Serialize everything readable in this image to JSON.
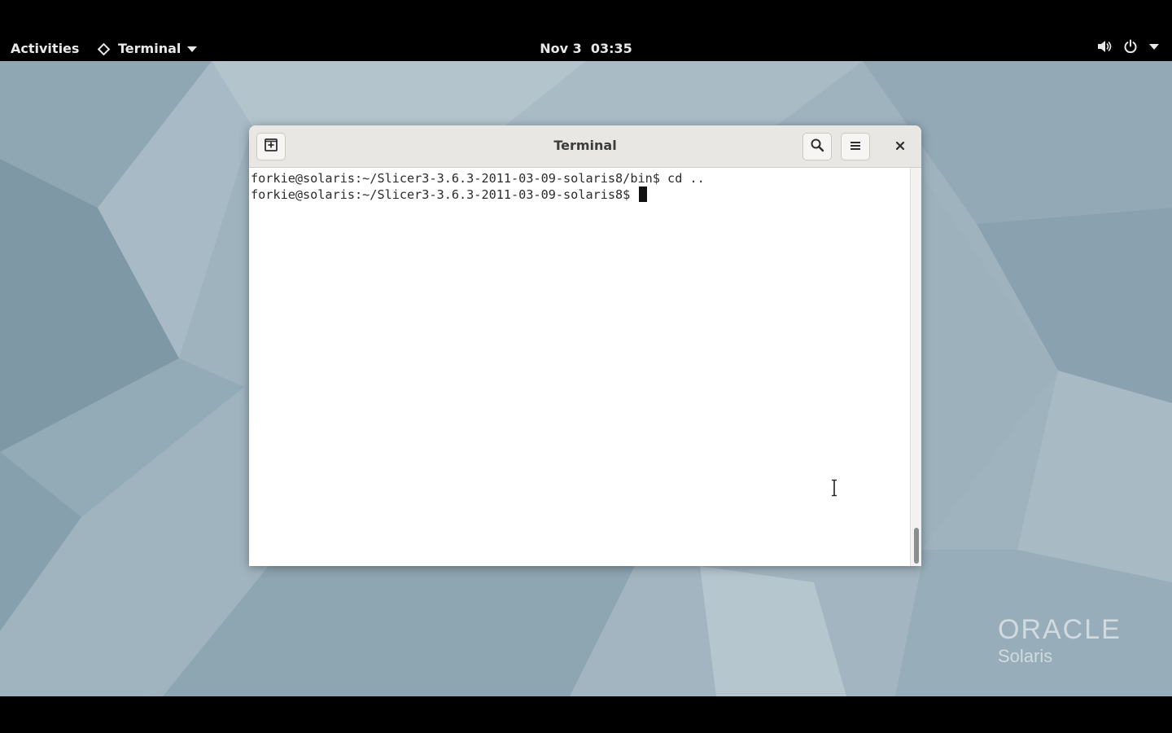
{
  "top_panel": {
    "activities_label": "Activities",
    "app_menu_label": "Terminal",
    "clock": "Nov 3  03:35",
    "icons": [
      "app-diamond-icon",
      "volume-icon",
      "power-icon",
      "system-menu-arrow-icon"
    ]
  },
  "desktop": {
    "logo": {
      "brand": "ORACLE",
      "product": "Solaris"
    }
  },
  "terminal": {
    "title": "Terminal",
    "buttons": [
      "new-tab-icon",
      "search-icon",
      "hamburger-menu-icon",
      "close-icon"
    ],
    "lines": [
      "forkie@solaris:~/Slicer3-3.6.3-2011-03-09-solaris8/bin$ cd ..",
      "forkie@solaris:~/Slicer3-3.6.3-2011-03-09-solaris8$ "
    ]
  },
  "colors": {
    "panel_bg": "#000000",
    "desktop_base": "#9fb3bf",
    "titlebar_bg": "#e9e7e4",
    "terminal_bg": "#ffffff",
    "terminal_fg": "#2b2b2b"
  }
}
